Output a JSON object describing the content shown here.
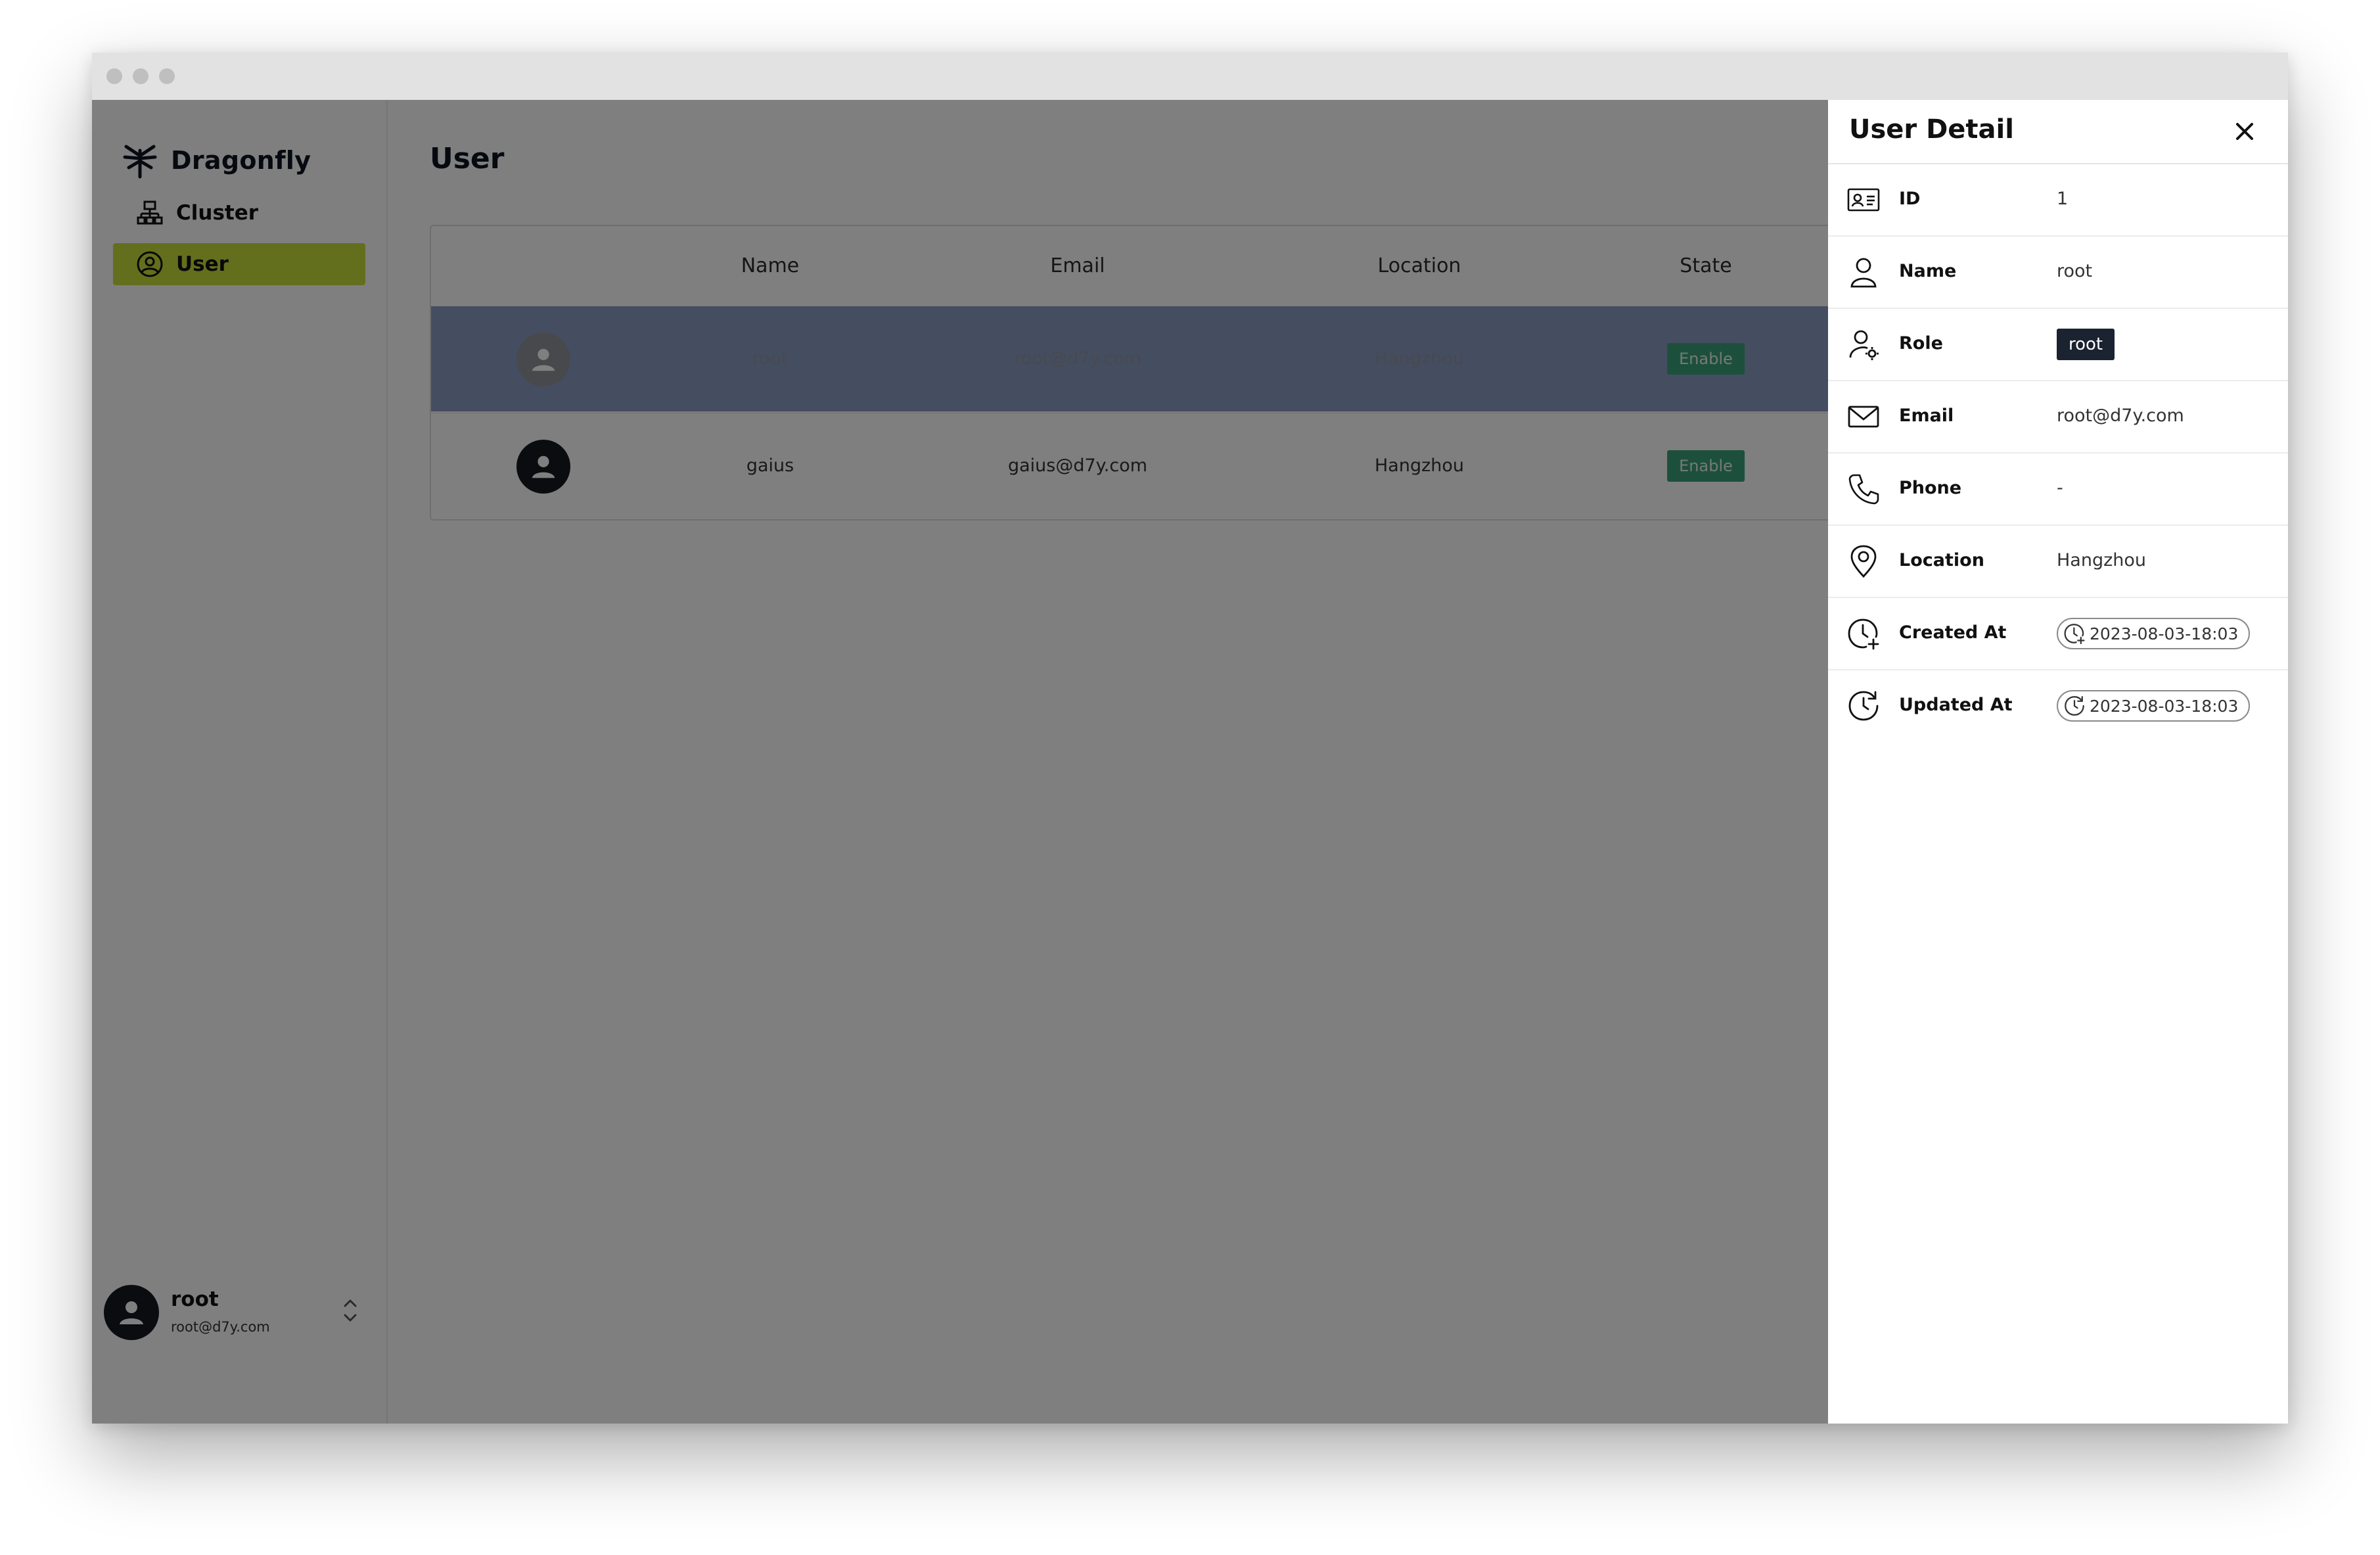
{
  "app": {
    "brand_name": "Dragonfly",
    "accent_color": "#c7de3a"
  },
  "sidebar": {
    "items": [
      {
        "label": "Cluster",
        "icon": "cluster-icon",
        "active": false
      },
      {
        "label": "User",
        "icon": "user-circle-icon",
        "active": true
      }
    ],
    "current_user": {
      "name": "root",
      "email": "root@d7y.com"
    }
  },
  "main": {
    "title": "User",
    "table": {
      "columns": [
        "Name",
        "Email",
        "Location",
        "State"
      ],
      "rows": [
        {
          "name": "root",
          "email": "root@d7y.com",
          "location": "Hangzhou",
          "state": "Enable",
          "selected": true
        },
        {
          "name": "gaius",
          "email": "gaius@d7y.com",
          "location": "Hangzhou",
          "state": "Enable",
          "selected": false
        }
      ],
      "state_color": "#3aa179"
    }
  },
  "drawer": {
    "title": "User Detail",
    "fields": {
      "id": {
        "label": "ID",
        "value": "1",
        "icon": "id-card-icon"
      },
      "name": {
        "label": "Name",
        "value": "root",
        "icon": "person-icon"
      },
      "role": {
        "label": "Role",
        "value": "root",
        "icon": "user-gear-icon"
      },
      "email": {
        "label": "Email",
        "value": "root@d7y.com",
        "icon": "mail-icon"
      },
      "phone": {
        "label": "Phone",
        "value": "-",
        "icon": "phone-icon"
      },
      "location": {
        "label": "Location",
        "value": "Hangzhou",
        "icon": "location-pin-icon"
      },
      "created_at": {
        "label": "Created At",
        "value": "2023-08-03-18:03",
        "icon": "clock-plus-icon"
      },
      "updated_at": {
        "label": "Updated At",
        "value": "2023-08-03-18:03",
        "icon": "clock-refresh-icon"
      }
    }
  }
}
